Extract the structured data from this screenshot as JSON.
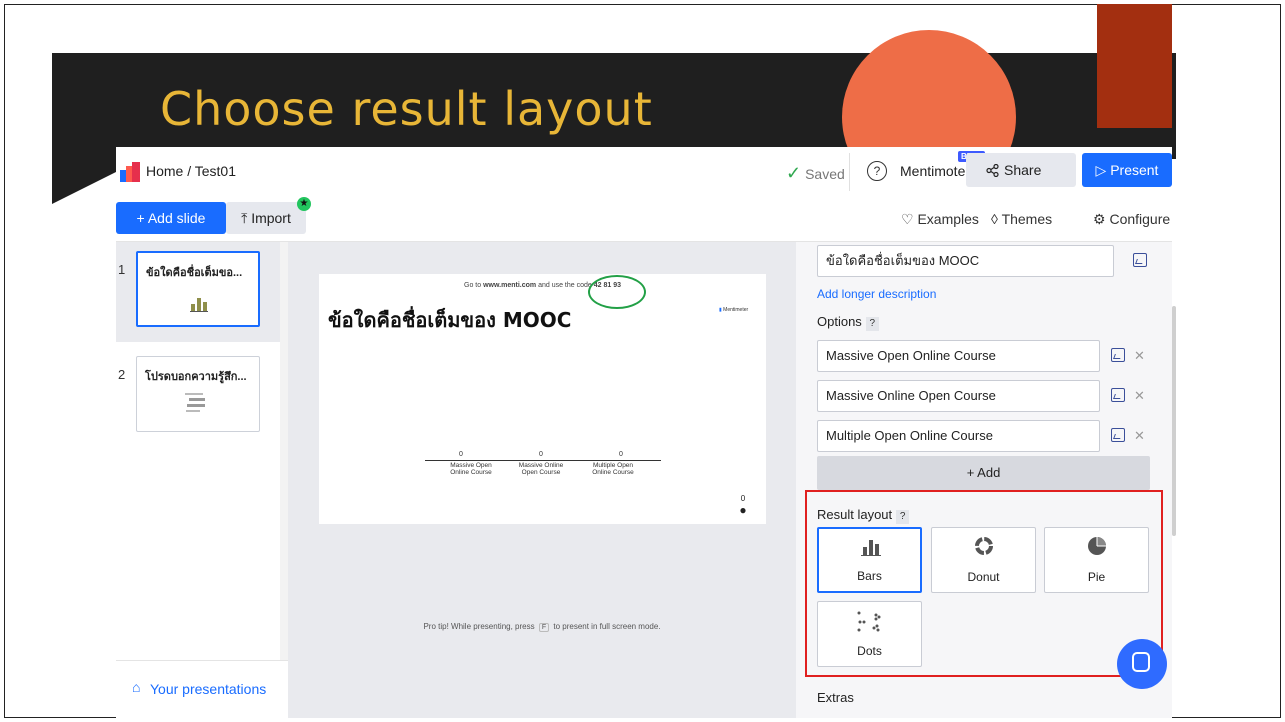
{
  "slide": {
    "title": "Choose result layout"
  },
  "topbar": {
    "breadcrumb": "Home / Test01",
    "saved": "Saved",
    "help": "?",
    "mentimote": "Mentimote",
    "beta": "BETA",
    "share": "Share",
    "present": "Present",
    "colors": {
      "primary": "#196cff",
      "saved_check": "#2fa84f"
    }
  },
  "toolbar": {
    "add_slide": "+ Add slide",
    "import": "Import",
    "examples": "Examples",
    "themes": "Themes",
    "configure": "Configure"
  },
  "sidebar": {
    "slides": [
      {
        "number": "1",
        "title": "ข้อใดคือชื่อเต็มขอ..."
      },
      {
        "number": "2",
        "title": "โปรดบอกความรู้สึก..."
      }
    ],
    "your_presentations": "Your presentations"
  },
  "preview": {
    "go_to_prefix": "Go to ",
    "go_to_site": "www.menti.com",
    "go_to_middle": " and use the code ",
    "code": "42 81 93",
    "question": "ข้อใดคือชื่อเต็มของ MOOC",
    "brand": "Mentimeter",
    "counts": [
      "0",
      "0",
      "0"
    ],
    "option_labels": [
      "Massive Open Online Course",
      "Massive Online Open Course",
      "Multiple Open Online Course"
    ],
    "participants": "0",
    "pro_tip_before": "Pro tip! While presenting, press",
    "pro_tip_key": "F",
    "pro_tip_after": "to present in full screen mode."
  },
  "editor": {
    "question_value": "ข้อใดคือชื่อเต็มของ MOOC",
    "add_description": "Add longer description",
    "options_label": "Options",
    "options": [
      "Massive Open Online Course",
      "Massive Online Open Course",
      "Multiple Open Online Course"
    ],
    "add_option": "+ Add",
    "result_layout_label": "Result layout",
    "layouts": [
      "Bars",
      "Donut",
      "Pie",
      "Dots"
    ],
    "selected_layout": "Bars",
    "extras_label": "Extras"
  }
}
